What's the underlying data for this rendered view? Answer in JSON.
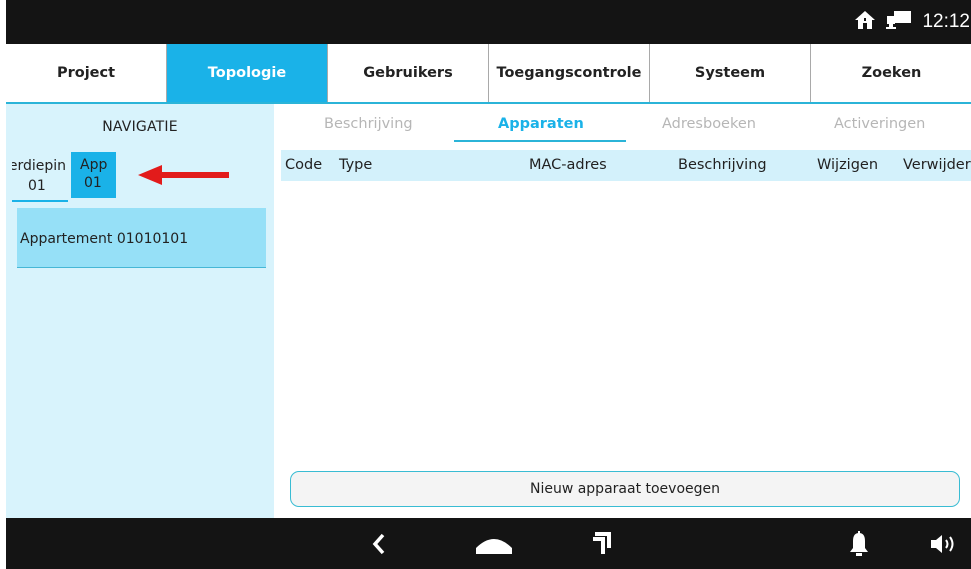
{
  "status": {
    "time": "12:12",
    "icons": [
      "home-icon",
      "network-icon"
    ]
  },
  "tabs": [
    {
      "label": "Project",
      "active": false
    },
    {
      "label": "Topologie",
      "active": true
    },
    {
      "label": "Gebruikers",
      "active": false
    },
    {
      "label": "Toegangscontrole",
      "active": false
    },
    {
      "label": "Systeem",
      "active": false
    },
    {
      "label": "Zoeken",
      "active": false
    }
  ],
  "sidebar": {
    "title": "NAVIGATIE",
    "breadcrumb": [
      {
        "line1": "Verdiepin",
        "line2": "01"
      },
      {
        "line1": "App",
        "line2": "01"
      }
    ],
    "items": [
      {
        "label": "Appartement 01010101"
      }
    ]
  },
  "subtabs": [
    {
      "label": "Beschrijving",
      "active": false
    },
    {
      "label": "Apparaten",
      "active": true
    },
    {
      "label": "Adresboeken",
      "active": false
    },
    {
      "label": "Activeringen",
      "active": false
    }
  ],
  "table": {
    "columns": [
      "Code",
      "Type",
      "MAC-adres",
      "Beschrijving",
      "Wijzigen",
      "Verwijderen"
    ]
  },
  "actions": {
    "add_device": "Nieuw apparaat toevoegen"
  },
  "bottom_nav": {
    "icons": [
      "back-icon",
      "home-icon",
      "recent-apps-icon",
      "bell-icon",
      "volume-icon"
    ]
  },
  "colors": {
    "accent": "#1ab2e8",
    "sidebar_bg": "#d8f3fc",
    "header_row": "#d3f1fb",
    "arrow": "#e21b1b",
    "bar": "#141414"
  }
}
